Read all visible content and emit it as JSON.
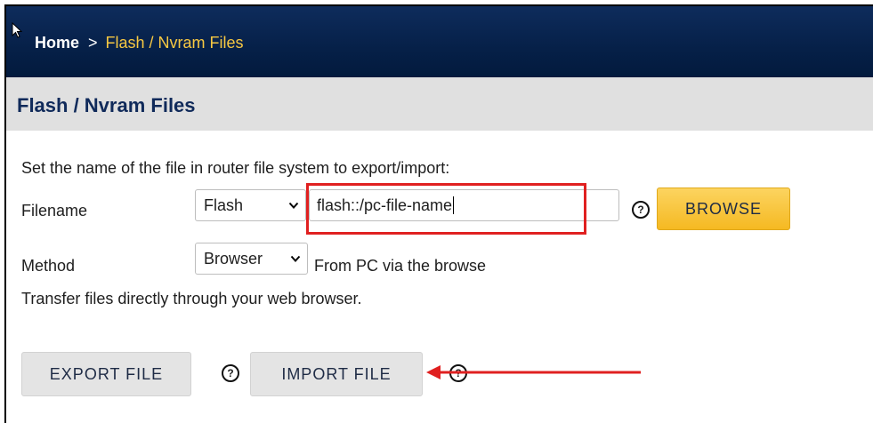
{
  "breadcrumb": {
    "home": "Home",
    "separator": ">",
    "current": "Flash / Nvram Files"
  },
  "section": {
    "title": "Flash / Nvram Files"
  },
  "form": {
    "intro": "Set the name of the file in router file system to export/import:",
    "filename_label": "Filename",
    "storage_select_value": "Flash",
    "filename_value": "flash::/pc-file-name",
    "browse_label": "BROWSE",
    "method_label": "Method",
    "method_select_value": "Browser",
    "method_note": "From PC via the browse",
    "transfer_note": "Transfer files directly through your web browser.",
    "help_glyph": "?"
  },
  "actions": {
    "export_label": "EXPORT FILE",
    "import_label": "IMPORT FILE"
  },
  "annotations": {
    "highlight_color": "#e02020",
    "arrow_color": "#e02020"
  },
  "colors": {
    "topbar": "#062048",
    "breadcrumb_current": "#f7c842",
    "section_title": "#102a5a",
    "browse_button": "#f5b922"
  },
  "icons": [
    "cursor-icon",
    "help-icon",
    "chevron-down-icon",
    "arrow-left-icon"
  ]
}
